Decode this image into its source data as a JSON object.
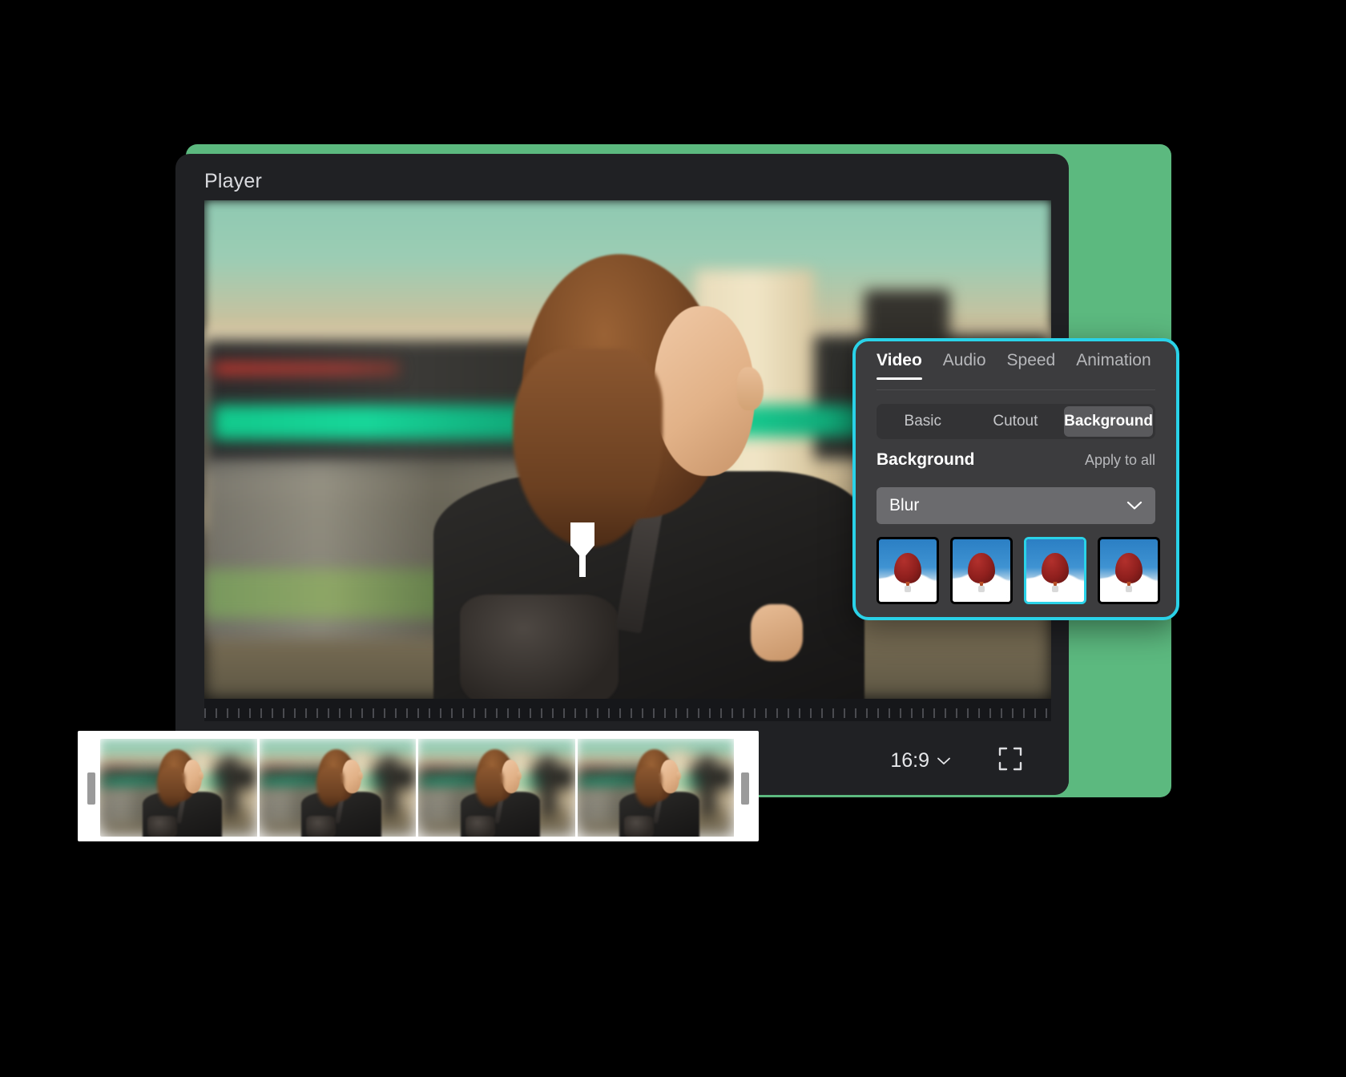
{
  "theme": {
    "accent_cyan": "#2ad2e8",
    "backdrop_green": "#5cb97f",
    "window_bg": "#202124",
    "panel_bg": "#3c3c3e"
  },
  "window": {
    "title": "Player"
  },
  "player_controls": {
    "aspect_ratio": "16:9",
    "aspect_chevron_icon": "chevron-down-icon",
    "fullscreen_icon": "fullscreen-icon"
  },
  "properties_panel": {
    "tabs": [
      {
        "label": "Video",
        "active": true
      },
      {
        "label": "Audio",
        "active": false
      },
      {
        "label": "Speed",
        "active": false
      },
      {
        "label": "Animation",
        "active": false
      }
    ],
    "segments": [
      {
        "label": "Basic",
        "active": false
      },
      {
        "label": "Cutout",
        "active": false
      },
      {
        "label": "Background",
        "active": true
      }
    ],
    "section_title": "Background",
    "apply_to_all_label": "Apply to all",
    "dropdown": {
      "value": "Blur",
      "chevron_icon": "chevron-down-icon"
    },
    "presets": [
      {
        "name": "blur-preset-1",
        "selected": false
      },
      {
        "name": "blur-preset-2",
        "selected": false
      },
      {
        "name": "blur-preset-3",
        "selected": true
      },
      {
        "name": "blur-preset-4",
        "selected": false
      }
    ]
  },
  "timeline": {
    "frame_count": 4,
    "left_trim_handle": "trim-handle-left",
    "right_trim_handle": "trim-handle-right",
    "playhead": "playhead-marker"
  }
}
